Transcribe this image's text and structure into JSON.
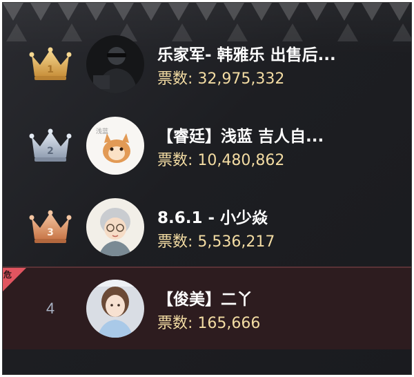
{
  "leaderboard": [
    {
      "rank": "1",
      "rank_style": "gold-crown-icon",
      "name": "乐家军- 韩雅乐 出售后...",
      "votes_label": "票数:",
      "votes": "32,975,332"
    },
    {
      "rank": "2",
      "rank_style": "silver-crown-icon",
      "name": "【睿廷】浅蓝 吉人自...",
      "votes_label": "票数:",
      "votes": "10,480,862"
    },
    {
      "rank": "3",
      "rank_style": "bronze-crown-icon",
      "name": "8.6.1 - 小少焱",
      "votes_label": "票数:",
      "votes": "5,536,217"
    },
    {
      "rank": "4",
      "rank_style": "number",
      "name": "【俊美】二丫",
      "votes_label": "票数:",
      "votes": "165,666",
      "badge": "危"
    }
  ],
  "colors": {
    "background": "#1d1e22",
    "name_text": "#ffffff",
    "votes_text": "#f3dca3",
    "gold": "#e3b96a",
    "silver": "#b9c4d4",
    "bronze": "#e0a37a",
    "danger_row": "#2d1c1f",
    "danger_badge": "#e05560"
  }
}
